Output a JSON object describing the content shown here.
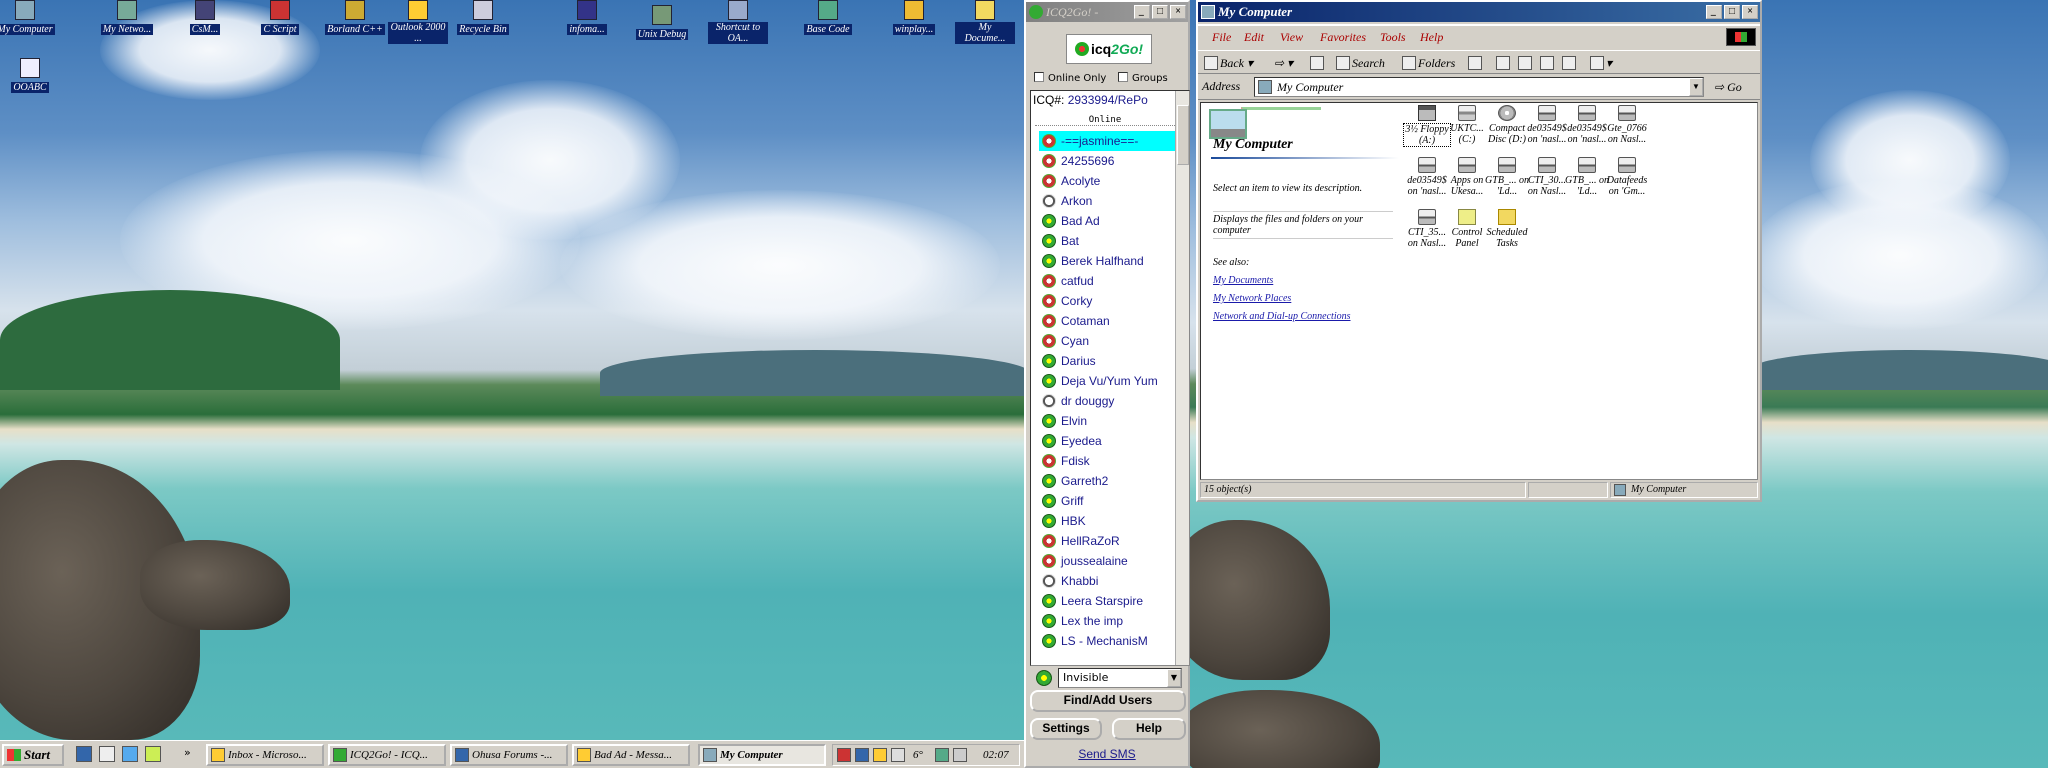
{
  "desktop_icons": [
    {
      "label": "My Computer"
    },
    {
      "label": "My Netwo..."
    },
    {
      "label": "CsM..."
    },
    {
      "label": "C Script"
    },
    {
      "label": "Borland C++"
    },
    {
      "label": "Outlook 2000 ..."
    },
    {
      "label": "Recycle Bin"
    },
    {
      "label": "infoma..."
    },
    {
      "label": "Unix Debug"
    },
    {
      "label": "Shortcut to OA..."
    },
    {
      "label": "Base Code"
    },
    {
      "label": "winplay..."
    },
    {
      "label": "My Docume..."
    },
    {
      "label": "OOABC"
    }
  ],
  "taskbar": {
    "start_label": "Start",
    "more_label": "»",
    "buttons": [
      {
        "label": "Inbox - Microso..."
      },
      {
        "label": "ICQ2Go! - ICQ..."
      },
      {
        "label": "Ohusa Forums -..."
      },
      {
        "label": "Bad Ad - Messa..."
      },
      {
        "label": "My Computer",
        "active": true
      }
    ],
    "tray_temp": "6°",
    "clock": "02:07"
  },
  "icq": {
    "title": "ICQ2Go! -",
    "logo_text": "icq",
    "logo_go": "2Go!",
    "online_only_label": "Online Only",
    "groups_label": "Groups",
    "icq_number_label": "ICQ#:",
    "icq_number_value": "2933994/RePo",
    "online_header": "Online",
    "contacts": [
      {
        "name": "-==jasmine==-",
        "status": "red",
        "selected": true
      },
      {
        "name": "24255696",
        "status": "red"
      },
      {
        "name": "Acolyte",
        "status": "red"
      },
      {
        "name": "Arkon",
        "status": "white"
      },
      {
        "name": "Bad Ad",
        "status": "green"
      },
      {
        "name": "Bat",
        "status": "green"
      },
      {
        "name": "Berek Halfhand",
        "status": "green"
      },
      {
        "name": "catfud",
        "status": "red"
      },
      {
        "name": "Corky",
        "status": "red"
      },
      {
        "name": "Cotaman",
        "status": "red"
      },
      {
        "name": "Cyan",
        "status": "red"
      },
      {
        "name": "Darius",
        "status": "green"
      },
      {
        "name": "Deja Vu/Yum Yum",
        "status": "green"
      },
      {
        "name": "dr douggy",
        "status": "white"
      },
      {
        "name": "Elvin",
        "status": "green"
      },
      {
        "name": "Eyedea",
        "status": "green"
      },
      {
        "name": "Fdisk",
        "status": "red"
      },
      {
        "name": "Garreth2",
        "status": "green"
      },
      {
        "name": "Griff",
        "status": "green"
      },
      {
        "name": "HBK",
        "status": "green"
      },
      {
        "name": "HellRaZoR",
        "status": "red"
      },
      {
        "name": "joussealaine",
        "status": "red"
      },
      {
        "name": "Khabbi",
        "status": "white"
      },
      {
        "name": "Leera Starspire",
        "status": "green"
      },
      {
        "name": "Lex the imp",
        "status": "green"
      },
      {
        "name": "LS - MechanisM",
        "status": "green"
      }
    ],
    "status_value": "Invisible",
    "find_add_label": "Find/Add Users",
    "settings_label": "Settings",
    "help_label": "Help",
    "send_sms_label": "Send SMS"
  },
  "explorer": {
    "title": "My Computer",
    "menu": [
      "File",
      "Edit",
      "View",
      "Favorites",
      "Tools",
      "Help"
    ],
    "toolbar": {
      "back": "Back",
      "search": "Search",
      "folders": "Folders"
    },
    "address_label": "Address",
    "address_value": "My Computer",
    "go_label": "Go",
    "left_title": "My Computer",
    "select_hint": "Select an item to view its description.",
    "description": "Displays the files and folders on your computer",
    "see_also": "See also:",
    "links": [
      "My Documents",
      "My Network Places",
      "Network and Dial-up Connections"
    ],
    "items": [
      {
        "label": "3½ Floppy (A:)",
        "kind": "floppy"
      },
      {
        "label": "UKTC... (C:)",
        "kind": "drive"
      },
      {
        "label": "Compact Disc (D:)",
        "kind": "cd"
      },
      {
        "label": "de03549$ on 'nasl...",
        "kind": "net"
      },
      {
        "label": "de03549$ on 'nasl...",
        "kind": "net"
      },
      {
        "label": "Gte_0766 on Nasl...",
        "kind": "net"
      },
      {
        "label": "de03549$ on 'nasl...",
        "kind": "net"
      },
      {
        "label": "Apps on Ukesa...",
        "kind": "net"
      },
      {
        "label": "GTB_... on 'Ld...",
        "kind": "net"
      },
      {
        "label": "CTI_30... on Nasl...",
        "kind": "net"
      },
      {
        "label": "GTB_... on 'Ld...",
        "kind": "net"
      },
      {
        "label": "Datafeeds on 'Gm...",
        "kind": "net"
      },
      {
        "label": "CTI_35... on Nasl...",
        "kind": "net"
      },
      {
        "label": "Control Panel",
        "kind": "cpl"
      },
      {
        "label": "Scheduled Tasks",
        "kind": "folder"
      }
    ],
    "status_objects": "15 object(s)",
    "status_location": "My Computer"
  }
}
